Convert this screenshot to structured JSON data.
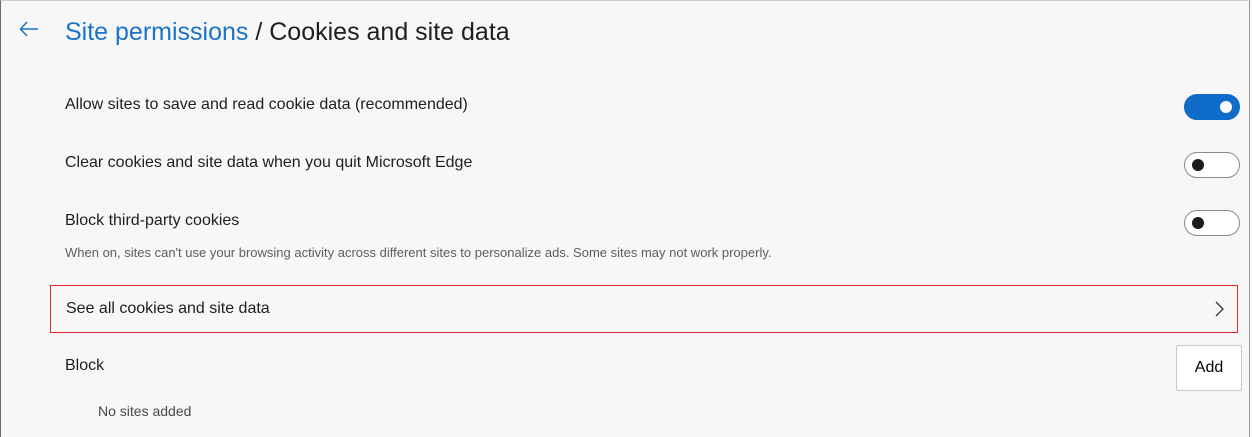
{
  "header": {
    "breadcrumb_parent": "Site permissions",
    "separator": " / ",
    "current_page": "Cookies and site data",
    "back_icon": "back-arrow-icon"
  },
  "settings": [
    {
      "label": "Allow sites to save and read cookie data (recommended)",
      "enabled": true
    },
    {
      "label": "Clear cookies and site data when you quit Microsoft Edge",
      "enabled": false
    },
    {
      "label": "Block third-party cookies",
      "enabled": false,
      "description": "When on, sites can't use your browsing activity across different sites to personalize ads. Some sites may not work properly."
    }
  ],
  "see_all": {
    "label": "See all cookies and site data",
    "icon": "chevron-right-icon"
  },
  "block": {
    "heading": "Block",
    "add_label": "Add",
    "empty_text": "No sites added"
  },
  "colors": {
    "accent": "#0f6cc8",
    "link": "#1a73c8",
    "highlight_border": "#e0282d",
    "background": "#f7f7f7"
  }
}
